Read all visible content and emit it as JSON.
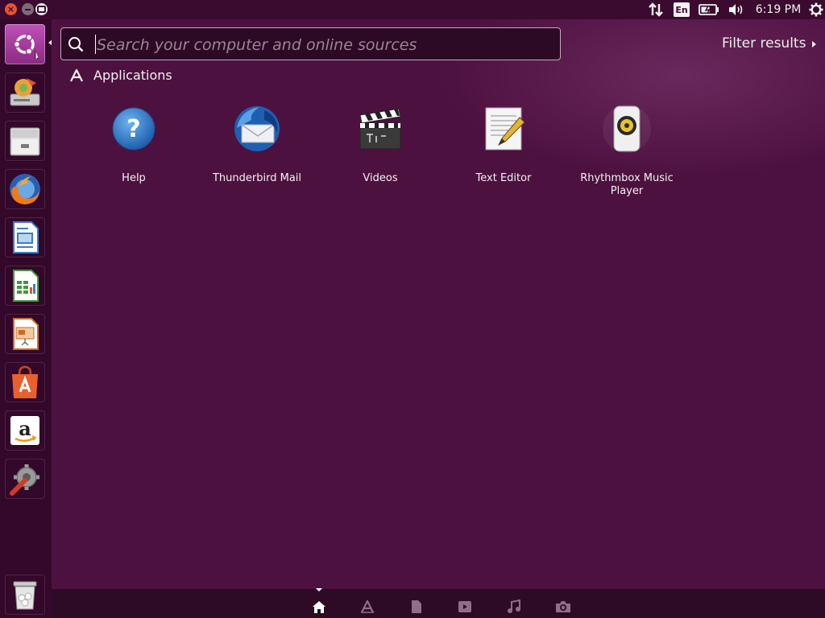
{
  "top_panel": {
    "keyboard_layout": "En",
    "time": "6:19 PM"
  },
  "search": {
    "placeholder": "Search your computer and online sources",
    "value": ""
  },
  "filter": {
    "label": "Filter results"
  },
  "category": {
    "label": "Applications"
  },
  "apps": [
    {
      "label": "Help",
      "icon": "help-icon"
    },
    {
      "label": "Thunderbird Mail",
      "icon": "thunderbird-icon"
    },
    {
      "label": "Videos",
      "icon": "videos-icon"
    },
    {
      "label": "Text Editor",
      "icon": "text-editor-icon"
    },
    {
      "label": "Rhythmbox Music Player",
      "icon": "rhythmbox-icon"
    }
  ],
  "launcher": [
    "dash-icon",
    "disk-icon",
    "files-icon",
    "firefox-icon",
    "writer-icon",
    "calc-icon",
    "impress-icon",
    "software-center-icon",
    "amazon-icon",
    "settings-icon",
    "trash-icon"
  ],
  "lenses": [
    "home-icon",
    "applications-icon",
    "files-icon",
    "videos-icon",
    "music-icon",
    "photos-icon"
  ],
  "colors": {
    "accent": "#e9502f",
    "dash_bg": "#4d1140",
    "launcher_bg": "#33082a"
  }
}
